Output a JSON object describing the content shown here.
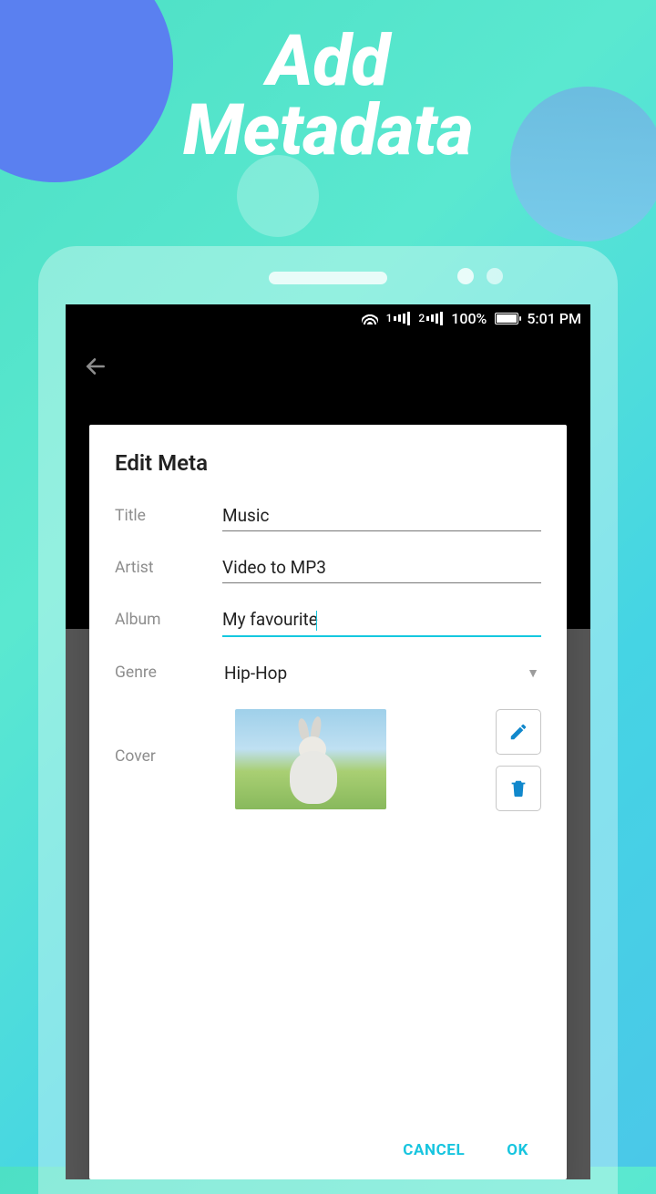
{
  "hero": {
    "line1": "Add",
    "line2": "Metadata"
  },
  "status": {
    "sim1_prefix": "1",
    "sim2_prefix": "2",
    "battery": "100%",
    "time": "5:01 PM"
  },
  "dialog": {
    "title": "Edit Meta",
    "labels": {
      "title": "Title",
      "artist": "Artist",
      "album": "Album",
      "genre": "Genre",
      "cover": "Cover"
    },
    "fields": {
      "title": "Music",
      "artist": "Video to MP3",
      "album": "My favourite",
      "genre": "Hip-Hop"
    },
    "actions": {
      "cancel": "CANCEL",
      "ok": "OK"
    }
  }
}
